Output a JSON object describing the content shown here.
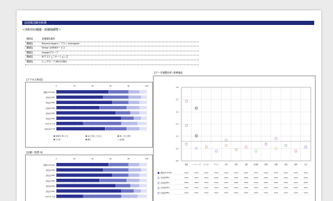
{
  "document": {
    "header": "自治体比較分析表",
    "subheading": "＜市町村の概要・財政指標等＞",
    "info_rows": [
      {
        "key": "団体名",
        "value": "北海道札幌市"
      },
      {
        "key": "業種名",
        "value": "Researchagent・プラン Interagent"
      },
      {
        "key": "業種名",
        "value": "Yahoo! JAPANサービス"
      },
      {
        "key": "業種名",
        "value": "Googleグループ"
      },
      {
        "key": "業種名",
        "value": "NTTコミュニケーションズ"
      },
      {
        "key": "業種名",
        "value": "ビッグローブ (BIGLOBE)"
      }
    ]
  },
  "panel_left_top": {
    "title": "【アクセス状況】",
    "rows": [
      "農業(Aclimate)",
      "北海道 (NW)",
      "北海道 (NW)",
      "北海道 (NW)",
      "北海道 (NW)",
      "北海道 (NW)",
      "Internal 4 Jp",
      "比較分析 5 ST"
    ],
    "ticks": [
      "0",
      "20",
      "40",
      "60",
      "80",
      "100"
    ],
    "legend": [
      "■ 意図的に導入する",
      "■ あまり導入されない",
      "■ 導入された割合",
      "■ その他",
      "■ 継続",
      "□ 未回答"
    ]
  },
  "panel_left_bottom": {
    "title": "【比較一覧表 B】",
    "rows": [
      "農業(Aclimate)",
      "北海道 (NW)",
      "北海道 (NW)",
      "北海道 (NW)",
      "北海道 (NW)",
      "北海道 (NW)",
      "Internal 4 Jp"
    ],
    "ticks": [
      "0",
      "20",
      "40",
      "60",
      "80",
      "100"
    ],
    "xlabels": [
      "調査結果",
      "市町村",
      "都道府県",
      "全国平均",
      "比較表",
      "Citizen"
    ]
  },
  "panel_right": {
    "title": "【データ相関分布 (参考値)】",
    "yticks": [
      "3.0",
      "2.5",
      "2.0",
      "1.5",
      "1.0",
      "0.5",
      "0.0"
    ],
    "columns": [
      "調査",
      "ミーティング",
      "ロバスト",
      "グラフ",
      "市町",
      "項目",
      "比較",
      "自治体",
      "指標",
      "分類",
      "比較",
      "参考",
      "合計"
    ],
    "table_rows": [
      "農業(Aclimate)",
      "北海道(NW)",
      "北海道(NW)",
      "北海道(NW)",
      "北海道(NW)"
    ]
  },
  "colors": {
    "header_bar": "#1e2a78",
    "bar_dark": "#2a3190",
    "bar_mid": "#6b72c2",
    "bar_light": "#b8bde6",
    "bar_pale": "#dfe1f4"
  }
}
